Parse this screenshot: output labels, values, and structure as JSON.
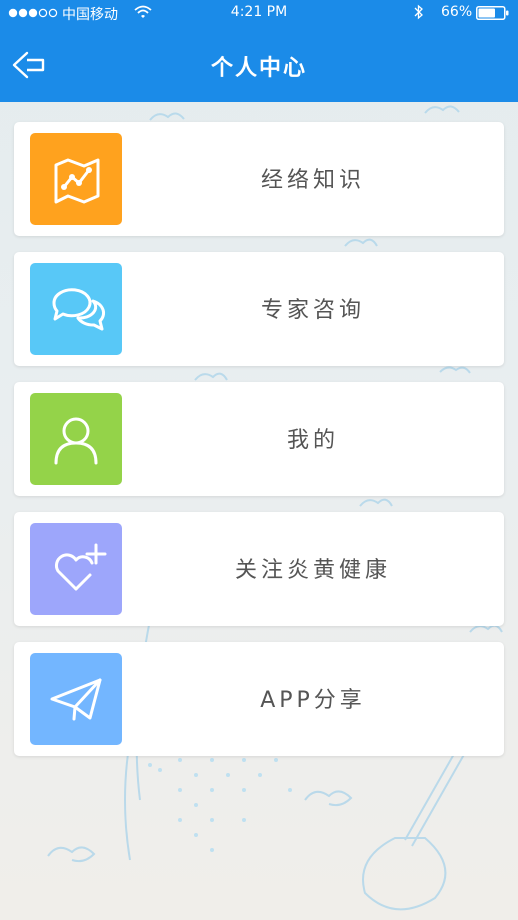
{
  "status_bar": {
    "carrier": "中国移动",
    "time": "4:21 PM",
    "battery": "66%",
    "battery_level": 0.66
  },
  "nav": {
    "title": "个人中心"
  },
  "menu": {
    "items": [
      {
        "label": "经络知识",
        "color": "#ffa21e",
        "icon": "map-icon"
      },
      {
        "label": "专家咨询",
        "color": "#58c8f7",
        "icon": "chat-bubbles-icon"
      },
      {
        "label": "我的",
        "color": "#94d349",
        "icon": "user-icon"
      },
      {
        "label": "关注炎黄健康",
        "color": "#9da6fb",
        "icon": "heart-plus-icon"
      },
      {
        "label": "APP分享",
        "color": "#73b6ff",
        "icon": "paper-plane-icon"
      }
    ]
  }
}
